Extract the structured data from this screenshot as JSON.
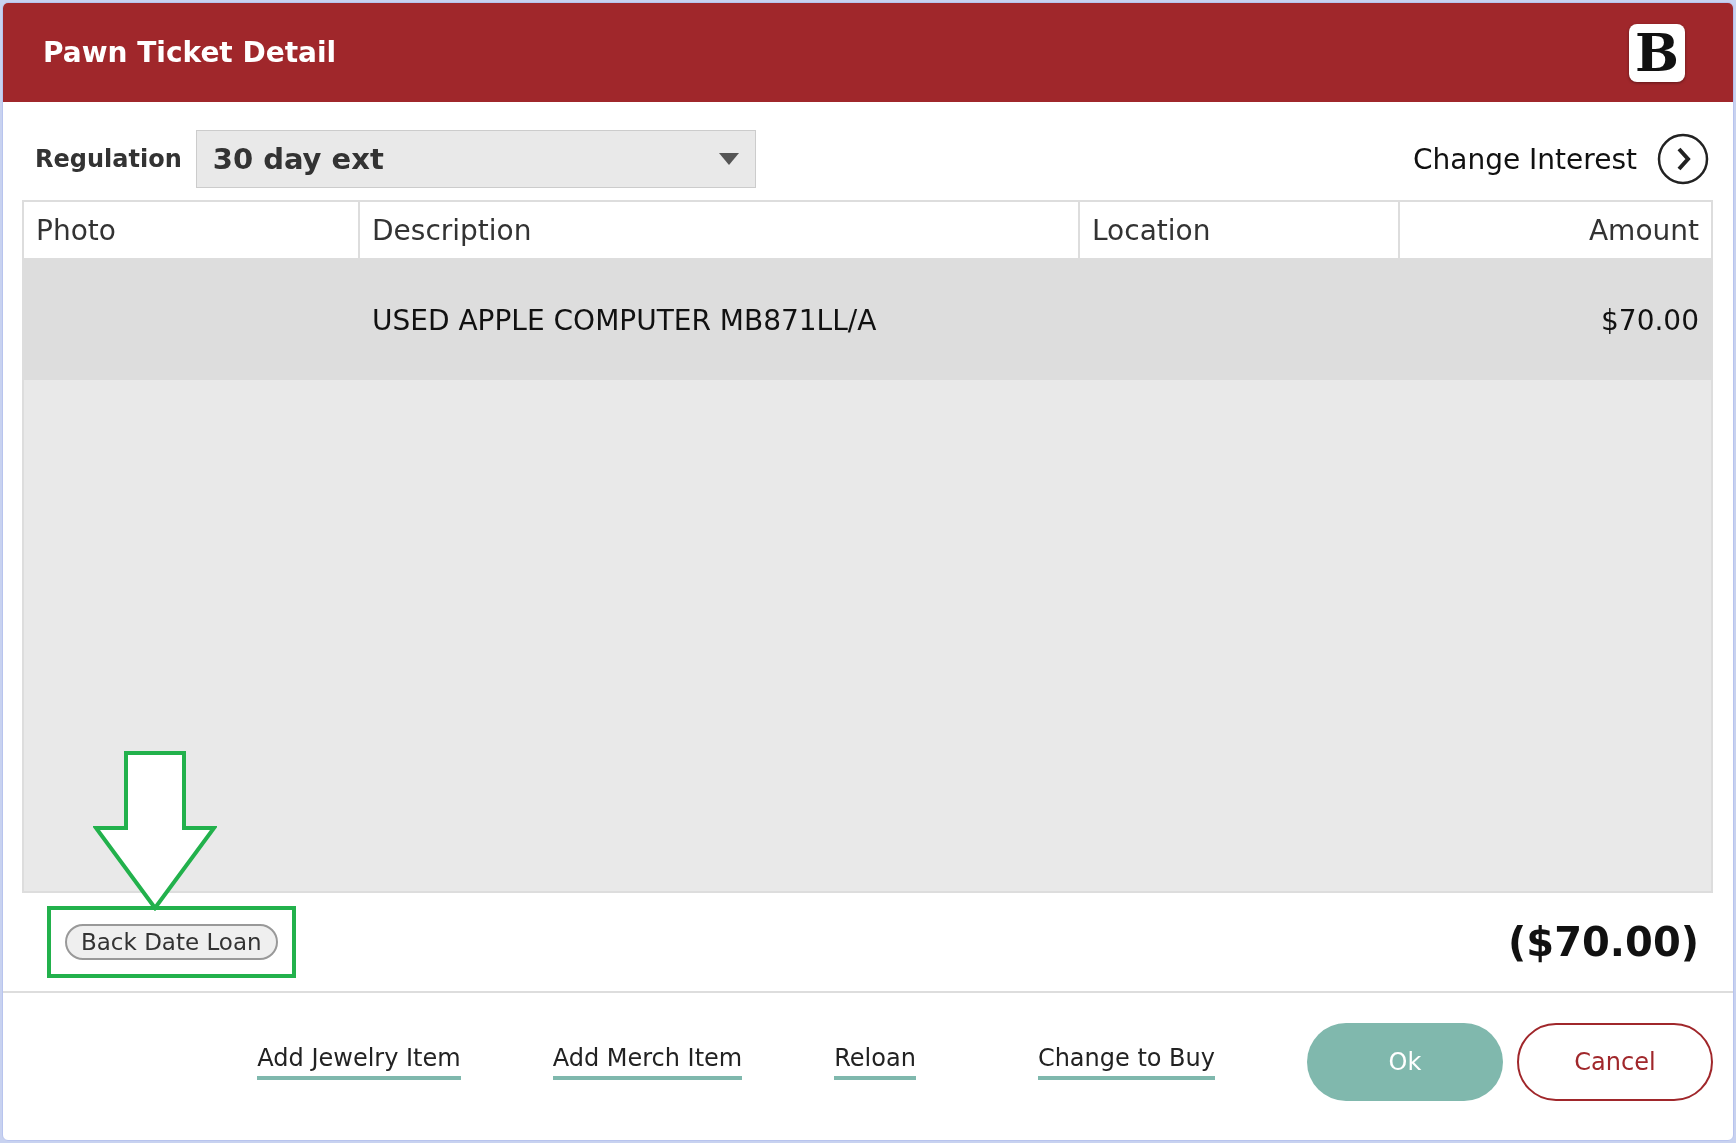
{
  "window": {
    "title": "Pawn Ticket Detail",
    "logo": "B"
  },
  "regulation": {
    "label": "Regulation",
    "value": "30 day ext"
  },
  "change_interest": {
    "label": "Change Interest"
  },
  "table": {
    "columns": [
      "Photo",
      "Description",
      "Location",
      "Amount"
    ],
    "rows": [
      {
        "photo": "",
        "description": "USED APPLE COMPUTER MB871LL/A",
        "location": "",
        "amount": "$70.00",
        "selected": true
      }
    ]
  },
  "back_date_button": {
    "label": "Back Date Loan",
    "highlighted": true
  },
  "total": "($70.00)",
  "links": [
    "Add Jewelry Item",
    "Add Merch Item",
    "Reloan",
    "Change to Buy"
  ],
  "buttons": [
    {
      "label": "Ok",
      "kind": "primary"
    },
    {
      "label": "Cancel",
      "kind": "secondary"
    }
  ]
}
